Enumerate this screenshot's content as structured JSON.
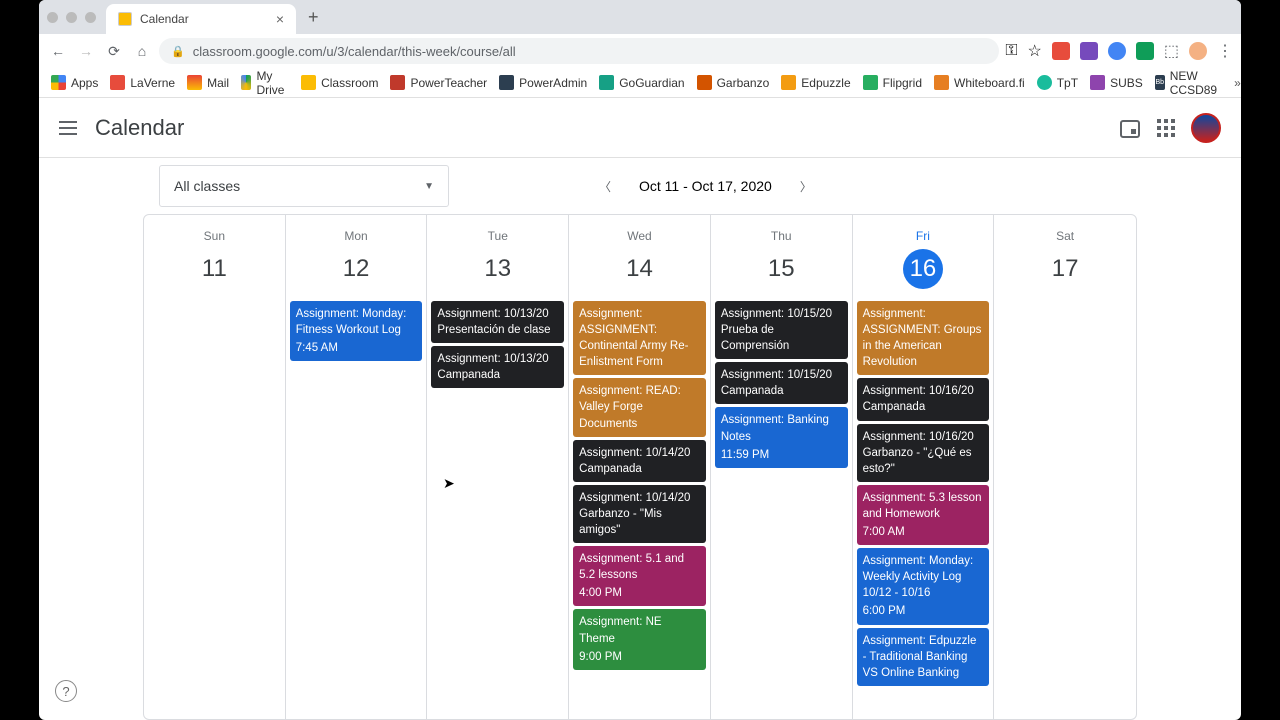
{
  "browser": {
    "tab_title": "Calendar",
    "url": "classroom.google.com/u/3/calendar/this-week/course/all",
    "bookmarks": [
      "Apps",
      "LaVerne",
      "Mail",
      "My Drive",
      "Classroom",
      "PowerTeacher",
      "PowerAdmin",
      "GoGuardian",
      "Garbanzo",
      "Edpuzzle",
      "Flipgrid",
      "Whiteboard.fi",
      "TpT",
      "SUBS",
      "NEW CCSD89"
    ]
  },
  "app": {
    "title": "Calendar",
    "dropdown_label": "All classes",
    "date_range": "Oct 11 - Oct 17, 2020"
  },
  "days": [
    {
      "name": "Sun",
      "num": "11",
      "today": false,
      "events": []
    },
    {
      "name": "Mon",
      "num": "12",
      "today": false,
      "events": [
        {
          "color": "ev-blue",
          "title": "Assignment: Monday: Fitness Workout Log",
          "time": "7:45 AM"
        }
      ]
    },
    {
      "name": "Tue",
      "num": "13",
      "today": false,
      "events": [
        {
          "color": "ev-black",
          "title": "Assignment: 10/13/20 Presentación de clase"
        },
        {
          "color": "ev-black",
          "title": "Assignment: 10/13/20 Campanada"
        }
      ]
    },
    {
      "name": "Wed",
      "num": "14",
      "today": false,
      "events": [
        {
          "color": "ev-orange",
          "title": "Assignment: ASSIGNMENT: Continental Army Re-Enlistment Form"
        },
        {
          "color": "ev-orange",
          "title": "Assignment: READ: Valley Forge Documents"
        },
        {
          "color": "ev-black",
          "title": "Assignment: 10/14/20 Campanada"
        },
        {
          "color": "ev-black",
          "title": "Assignment: 10/14/20 Garbanzo - \"Mis amigos\""
        },
        {
          "color": "ev-purple",
          "title": "Assignment: 5.1 and 5.2 lessons",
          "time": "4:00 PM"
        },
        {
          "color": "ev-green",
          "title": "Assignment: NE Theme",
          "time": "9:00 PM"
        }
      ]
    },
    {
      "name": "Thu",
      "num": "15",
      "today": false,
      "events": [
        {
          "color": "ev-black",
          "title": "Assignment: 10/15/20 Prueba de Comprensión"
        },
        {
          "color": "ev-black",
          "title": "Assignment: 10/15/20 Campanada"
        },
        {
          "color": "ev-blue",
          "title": "Assignment: Banking Notes",
          "time": "11:59 PM"
        }
      ]
    },
    {
      "name": "Fri",
      "num": "16",
      "today": true,
      "events": [
        {
          "color": "ev-orange",
          "title": "Assignment: ASSIGNMENT: Groups in the American Revolution"
        },
        {
          "color": "ev-black",
          "title": "Assignment: 10/16/20 Campanada"
        },
        {
          "color": "ev-black",
          "title": "Assignment: 10/16/20 Garbanzo - \"¿Qué es esto?\""
        },
        {
          "color": "ev-purple",
          "title": "Assignment: 5.3 lesson and Homework",
          "time": "7:00 AM"
        },
        {
          "color": "ev-blue",
          "title": "Assignment: Monday: Weekly Activity Log 10/12 - 10/16",
          "time": "6:00 PM"
        },
        {
          "color": "ev-blue",
          "title": "Assignment: Edpuzzle - Traditional Banking VS Online Banking"
        }
      ]
    },
    {
      "name": "Sat",
      "num": "17",
      "today": false,
      "events": []
    }
  ]
}
